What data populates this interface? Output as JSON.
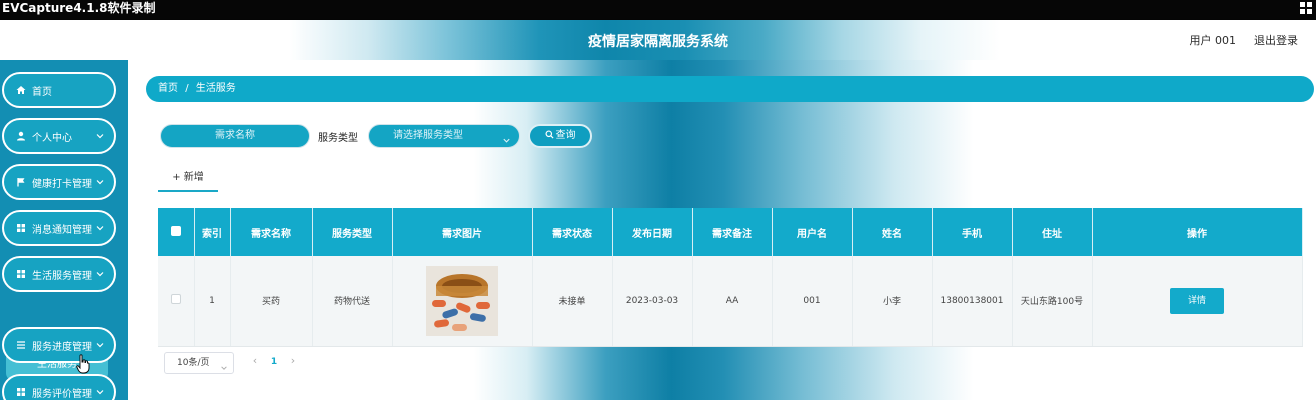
{
  "recorder": {
    "title": "EVCapture4.1.8软件录制"
  },
  "header": {
    "title": "疫情居家隔离服务系统",
    "user": "用户 001",
    "logout": "退出登录"
  },
  "sidebar": {
    "items": [
      {
        "label": "首页",
        "icon": "home-icon"
      },
      {
        "label": "个人中心",
        "icon": "person-icon"
      },
      {
        "label": "健康打卡管理",
        "icon": "flag-icon"
      },
      {
        "label": "消息通知管理",
        "icon": "grid-icon"
      },
      {
        "label": "生活服务管理",
        "icon": "grid-icon"
      },
      {
        "label": "服务进度管理",
        "icon": "list-icon"
      },
      {
        "label": "服务评价管理",
        "icon": "grid-icon"
      }
    ],
    "sub_item": "生活服务"
  },
  "breadcrumb": {
    "home": "首页",
    "separator": "/",
    "current": "生活服务"
  },
  "search": {
    "name_placeholder": "需求名称",
    "type_label": "服务类型",
    "type_placeholder": "请选择服务类型",
    "query_button": "查询"
  },
  "add_tab": "+ 新增",
  "table": {
    "headers": [
      "索引",
      "需求名称",
      "服务类型",
      "需求图片",
      "需求状态",
      "发布日期",
      "需求备注",
      "用户名",
      "姓名",
      "手机",
      "住址",
      "操作"
    ],
    "rows": [
      {
        "index": "1",
        "name": "买药",
        "service_type": "药物代送",
        "status": "未接单",
        "date": "2023-03-03",
        "remark": "AA",
        "username": "001",
        "real_name": "小李",
        "phone": "13800138001",
        "address": "天山东路100号",
        "action": "详情"
      }
    ]
  },
  "pagination": {
    "page_size": "10条/页",
    "prev": "‹",
    "current": "1",
    "next": "›"
  },
  "colors": {
    "primary": "#13aacb",
    "sidebar": "#138eb3",
    "header_gradient_center": "#0f86ab"
  }
}
